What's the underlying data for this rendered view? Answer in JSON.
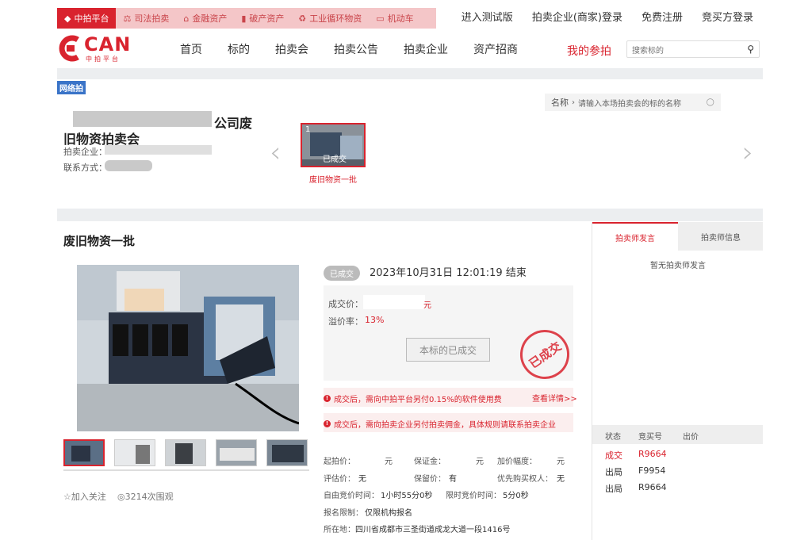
{
  "top_bar": {
    "categories": [
      {
        "label": "中拍平台",
        "icon": "diamond-icon"
      },
      {
        "label": "司法拍卖",
        "icon": "gavel-icon"
      },
      {
        "label": "金融资产",
        "icon": "bank-icon"
      },
      {
        "label": "破产资产",
        "icon": "chart-icon"
      },
      {
        "label": "工业循环物资",
        "icon": "recycle-icon"
      },
      {
        "label": "机动车",
        "icon": "car-icon"
      }
    ],
    "links": [
      "进入测试版",
      "拍卖企业(商家)登录",
      "免费注册",
      "竞买方登录"
    ]
  },
  "header": {
    "logo_text": "CAN",
    "logo_sub": "中拍平台",
    "nav": [
      "首页",
      "标的",
      "拍卖会",
      "拍卖公告",
      "拍卖企业",
      "资产招商"
    ],
    "my_bids": "我的参拍",
    "search_placeholder": "搜索标的"
  },
  "auction": {
    "net_badge": "网络拍",
    "title_line1": "公司废",
    "title_line2": "旧物资拍卖会",
    "company_label": "拍卖企业：",
    "contact_label": "联系方式：",
    "name_search_label": "名称",
    "name_search_placeholder": "请输入本场拍卖会的标的名称",
    "thumb_number": "1",
    "thumb_status": "已成交",
    "thumb_caption": "废旧物资一批"
  },
  "lot": {
    "title": "废旧物资一批",
    "status_badge": "已成交",
    "end_time": "2023年10月31日  12:01:19 结束",
    "deal_price_label": "成交价：",
    "deal_price_unit": "元",
    "premium_label": "溢价率：",
    "premium_value": "13%",
    "deal_button": "本标的已成交",
    "stamp_text": "已成交",
    "notice1": "成交后，需向中拍平台另付0.15%的软件使用费",
    "details_link": "查看详情>>",
    "notice2": "成交后，需向拍卖企业另付拍卖佣金，具体规则请联系拍卖企业",
    "follow": "加入关注",
    "views": "3214次围观",
    "info": {
      "start_price_label": "起拍价：",
      "start_price_unit": "元",
      "deposit_label": "保证金：",
      "deposit_unit": "元",
      "increment_label": "加价幅度：",
      "increment_unit": "元",
      "valuation_label": "评估价：",
      "valuation_value": "无",
      "reserve_label": "保留价：",
      "reserve_value": "有",
      "priority_label": "优先购买权人：",
      "priority_value": "无",
      "free_time_label": "自由竞价时间：",
      "free_time_value": "1小时55分0秒",
      "limited_time_label": "限时竞价时间：",
      "limited_time_value": "5分0秒",
      "signup_label": "报名限制：",
      "signup_value": "仅限机构报名",
      "location_label": "所在地：",
      "location_value": "四川省成都市三圣街道成龙大道一段1416号"
    }
  },
  "right_panel": {
    "tabs": [
      "拍卖师发言",
      "拍卖师信息"
    ],
    "empty_text": "暂无拍卖师发言",
    "bid_columns": [
      "状态",
      "竞买号",
      "出价"
    ],
    "bids": [
      {
        "status": "成交",
        "number": "R9664"
      },
      {
        "status": "出局",
        "number": "F9954"
      },
      {
        "status": "出局",
        "number": "R9664"
      }
    ]
  },
  "colors": {
    "brand": "#d9232e",
    "badge_blue": "#3a74c8"
  }
}
